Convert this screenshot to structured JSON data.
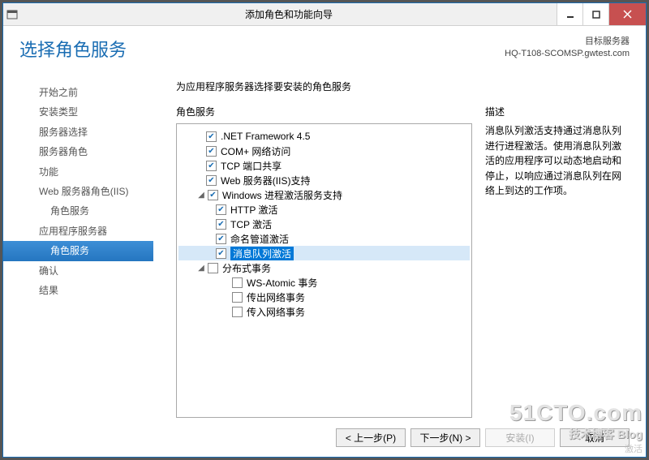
{
  "window": {
    "title": "添加角色和功能向导"
  },
  "header": {
    "page_title": "选择角色服务",
    "target_label": "目标服务器",
    "target_server": "HQ-T108-SCOMSP.gwtest.com"
  },
  "steps": [
    {
      "label": "开始之前"
    },
    {
      "label": "安装类型"
    },
    {
      "label": "服务器选择"
    },
    {
      "label": "服务器角色"
    },
    {
      "label": "功能"
    },
    {
      "label": "Web 服务器角色(IIS)"
    },
    {
      "label": "角色服务",
      "sub": true
    },
    {
      "label": "应用程序服务器"
    },
    {
      "label": "角色服务",
      "sub": true,
      "selected": true
    },
    {
      "label": "确认"
    },
    {
      "label": "结果"
    }
  ],
  "main": {
    "instruction": "为应用程序服务器选择要安装的角色服务",
    "roles_title": "角色服务",
    "desc_title": "描述",
    "description": "消息队列激活支持通过消息队列进行进程激活。使用消息队列激活的应用程序可以动态地启动和停止，以响应通过消息队列在网络上到达的工作项。",
    "tree": [
      {
        "label": ".NET Framework 4.5",
        "indent": 0,
        "checked": true
      },
      {
        "label": "COM+ 网络访问",
        "indent": 0,
        "checked": true
      },
      {
        "label": "TCP 端口共享",
        "indent": 0,
        "checked": true
      },
      {
        "label": "Web 服务器(IIS)支持",
        "indent": 0,
        "checked": true
      },
      {
        "label": "Windows 进程激活服务支持",
        "indent": 0,
        "checked": true,
        "expander": "▢",
        "withexp": true
      },
      {
        "label": "HTTP 激活",
        "indent": 1,
        "checked": true
      },
      {
        "label": "TCP 激活",
        "indent": 1,
        "checked": true
      },
      {
        "label": "命名管道激活",
        "indent": 1,
        "checked": true
      },
      {
        "label": "消息队列激活",
        "indent": 1,
        "checked": true,
        "hl": true
      },
      {
        "label": "分布式事务",
        "indent": 0,
        "checked": false,
        "expander": "▢",
        "withexp": true
      },
      {
        "label": "WS-Atomic 事务",
        "indent": 1,
        "checked": false,
        "nochk": true
      },
      {
        "label": "传出网络事务",
        "indent": 1,
        "checked": false,
        "nochk": true
      },
      {
        "label": "传入网络事务",
        "indent": 1,
        "checked": false,
        "nochk": true
      }
    ]
  },
  "footer": {
    "prev": "< 上一步(P)",
    "next": "下一步(N) >",
    "install": "安装(I)",
    "cancel": "取消"
  },
  "watermark": {
    "main": "51CTO.com",
    "sub": "技术博客 Blog",
    "small": "激活"
  }
}
